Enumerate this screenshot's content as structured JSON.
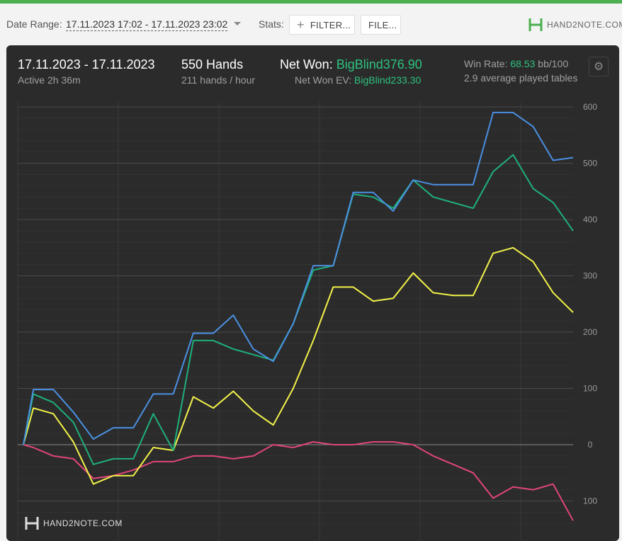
{
  "colors": {
    "accent": "#4caf50",
    "net_won": "#2ec27e",
    "blue": "#4a90e2",
    "green": "#1fb07a",
    "yellow": "#f2f24a",
    "pink": "#e0457a"
  },
  "toolbar": {
    "date_range_label": "Date Range:",
    "date_range_value": "17.11.2023 17:02 - 17.11.2023 23:02",
    "stats_label": "Stats:",
    "filter_label": "FILTER...",
    "file_label": "FILE...",
    "logo_text": "HAND2NOTE.COM"
  },
  "header": {
    "date_span": "17.11.2023 - 17.11.2023",
    "active": "Active 2h 36m",
    "hands": "550 Hands",
    "hands_per_hour": "211 hands / hour",
    "net_won_label": "Net Won:",
    "net_won_value": "BigBlind376.90",
    "net_won_ev_label": "Net Won  EV:",
    "net_won_ev_value": "BigBlind233.30",
    "win_rate_label": "Win Rate:",
    "win_rate_value": "68.53",
    "win_rate_unit": "bb/100",
    "avg_tables": "2.9 average played tables"
  },
  "footer": {
    "logo_text": "HAND2NOTE.COM"
  },
  "chart_data": {
    "type": "line",
    "title": "",
    "xlabel": "",
    "ylabel": "",
    "ylim": [
      -140,
      610
    ],
    "y_ticks": [
      600,
      500,
      400,
      300,
      200,
      100,
      0,
      100
    ],
    "x": [
      0,
      2,
      6,
      10,
      14,
      18,
      22,
      26,
      30,
      34,
      38,
      42,
      46,
      50,
      54,
      58,
      62,
      66,
      70,
      74,
      78,
      82,
      86,
      90,
      94,
      98,
      102,
      106,
      110
    ],
    "series": [
      {
        "color": "#4a90e2",
        "values": [
          0,
          98,
          98,
          58,
          10,
          30,
          30,
          90,
          90,
          198,
          198,
          230,
          170,
          148,
          215,
          318,
          318,
          448,
          448,
          415,
          470,
          462,
          462,
          462,
          590,
          590,
          565,
          505,
          510
        ]
      },
      {
        "color": "#1fb07a",
        "values": [
          0,
          90,
          75,
          40,
          -35,
          -25,
          -25,
          55,
          -10,
          185,
          185,
          170,
          160,
          150,
          215,
          310,
          318,
          445,
          440,
          420,
          470,
          440,
          430,
          420,
          485,
          515,
          455,
          430,
          380
        ]
      },
      {
        "color": "#f2f24a",
        "values": [
          0,
          65,
          55,
          5,
          -70,
          -55,
          -55,
          -5,
          -10,
          85,
          65,
          95,
          60,
          35,
          100,
          185,
          280,
          280,
          255,
          260,
          305,
          270,
          265,
          265,
          340,
          350,
          325,
          270,
          235
        ]
      },
      {
        "color": "#e0457a",
        "values": [
          0,
          -5,
          -20,
          -25,
          -60,
          -55,
          -45,
          -30,
          -30,
          -20,
          -20,
          -25,
          -20,
          0,
          -5,
          5,
          0,
          0,
          5,
          5,
          0,
          -20,
          -35,
          -50,
          -95,
          -75,
          -80,
          -70,
          -135
        ]
      }
    ]
  }
}
